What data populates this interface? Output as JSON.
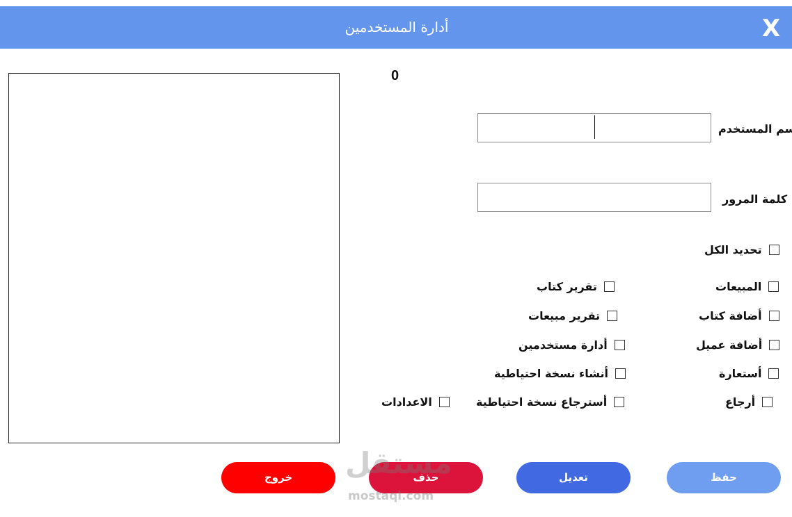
{
  "window": {
    "title": "أدارة المستخدمين",
    "close_label": "X",
    "titlebar_color": "#6495ed"
  },
  "counter": "0",
  "form": {
    "username_label": "أسم المستخدم",
    "username_value": "",
    "password_label": "كلمة المرور",
    "password_value": ""
  },
  "permissions": {
    "select_all": "تحديد الكل",
    "sales": "المبيعات",
    "add_book": "أضافة كتاب",
    "add_customer": "أضافة عميل",
    "borrow": "أستعارة",
    "return": "أرجاع",
    "book_report": "تقرير كتاب",
    "sales_report": "تقرير مبيعات",
    "manage_users": "أدارة مستخدمين",
    "create_backup": "أنشاء نسخة احتياطية",
    "restore_backup": "أسترجاع نسخة احتياطية",
    "settings": "الاعدادات"
  },
  "buttons": {
    "save": "حفظ",
    "edit": "تعديل",
    "delete": "حذف",
    "exit": "خروج",
    "save_color": "#6f9ef0",
    "edit_color": "#4169e1",
    "delete_color": "#dc143c",
    "exit_color": "#ff0000"
  },
  "watermark": {
    "arabic": "مستقل",
    "latin": "mostaql.com"
  }
}
